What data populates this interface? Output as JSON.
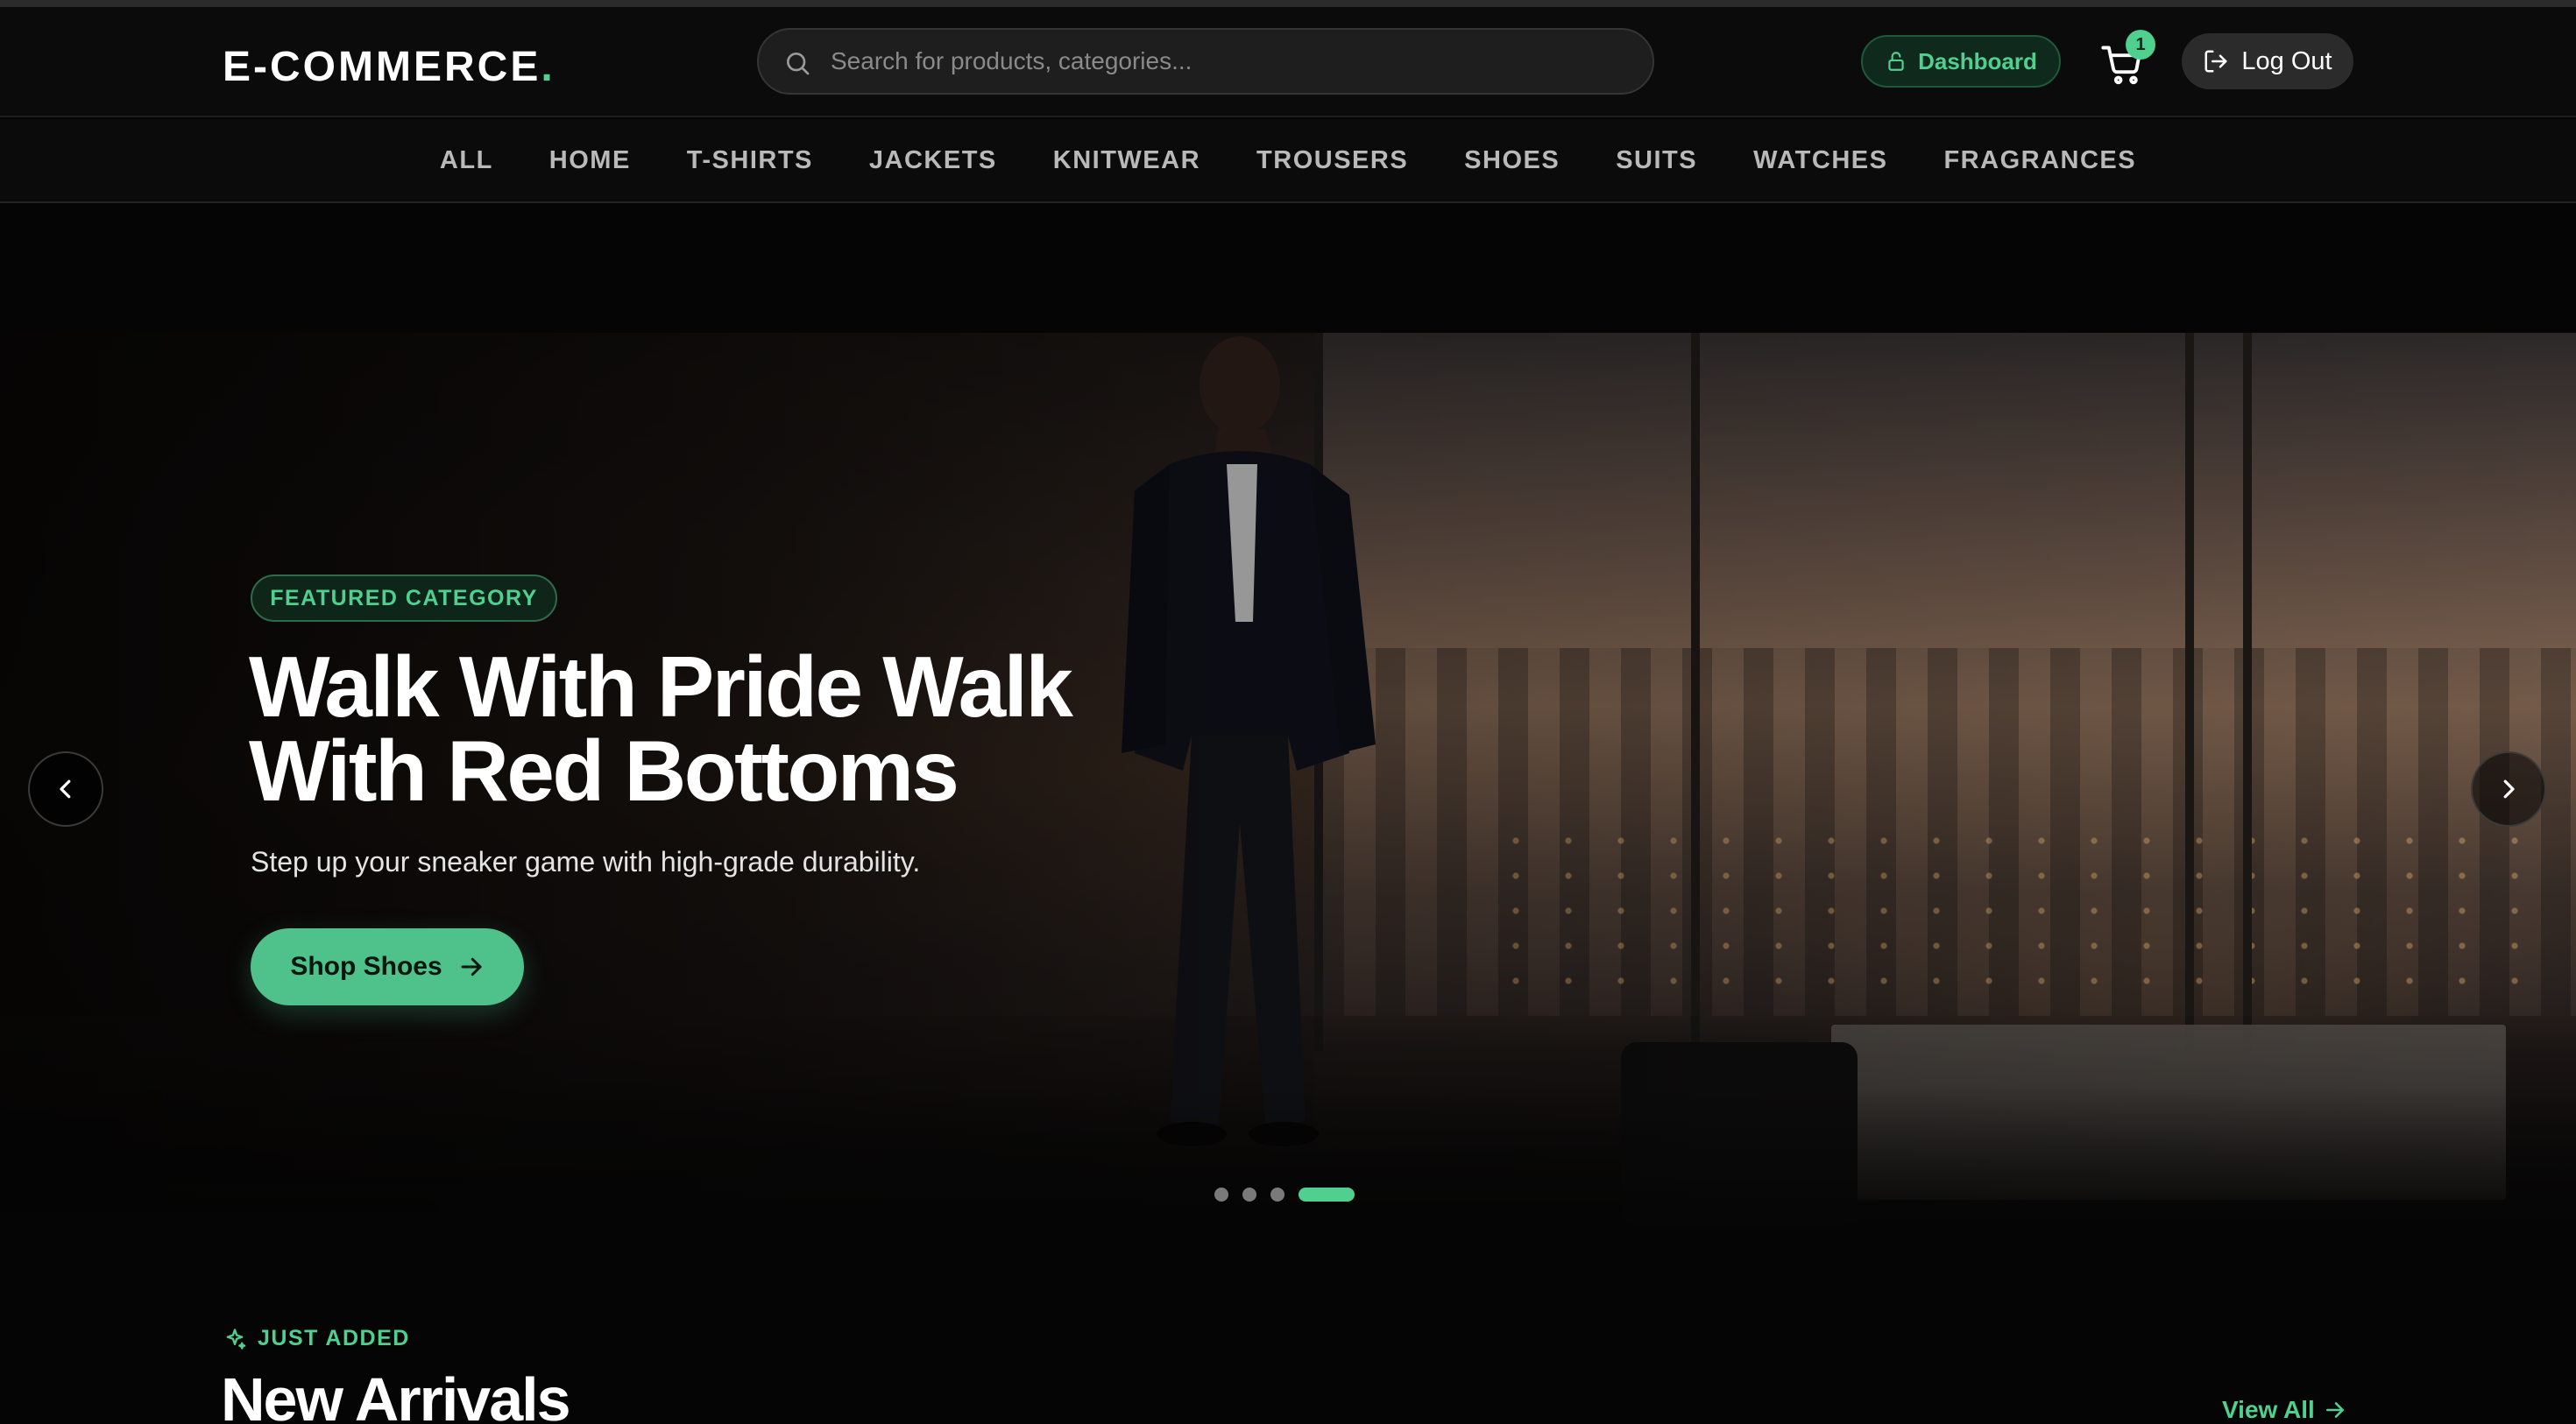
{
  "header": {
    "logo_text": "E-COMMERCE",
    "logo_dot": ".",
    "search_placeholder": "Search for products, categories...",
    "dashboard_label": "Dashboard",
    "cart_count": "1",
    "logout_label": "Log Out"
  },
  "nav": {
    "items": [
      "ALL",
      "HOME",
      "T-SHIRTS",
      "JACKETS",
      "KNITWEAR",
      "TROUSERS",
      "SHOES",
      "SUITS",
      "WATCHES",
      "FRAGRANCES"
    ]
  },
  "hero": {
    "badge": "FEATURED CATEGORY",
    "title": "Walk With Pride Walk With Red Bottoms",
    "subtitle": "Step up your sneaker game with high-grade durability.",
    "cta_label": "Shop Shoes",
    "slide_count": 4,
    "active_slide": 4
  },
  "section": {
    "eyebrow": "JUST ADDED",
    "title": "New Arrivals",
    "view_all_label": "View All"
  },
  "colors": {
    "accent": "#4fd08f",
    "background": "#050505",
    "header_bg": "#0b0b0b"
  },
  "icons": {
    "search": "search-icon",
    "dashboard": "lock-icon",
    "cart": "cart-icon",
    "logout": "logout-icon",
    "cta": "arrow-right-icon",
    "prev": "chevron-left-icon",
    "next": "chevron-right-icon",
    "eyebrow": "sparkle-icon"
  }
}
